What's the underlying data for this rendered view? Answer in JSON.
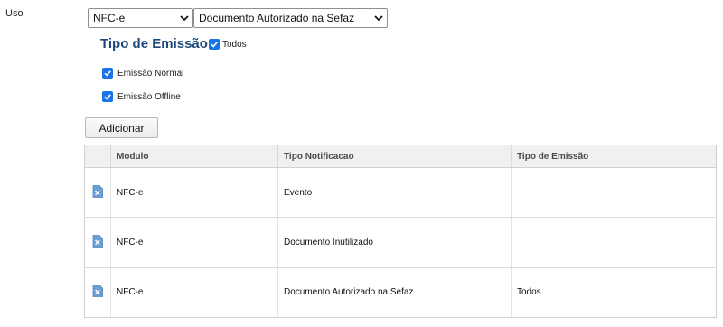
{
  "uso": {
    "label": "Uso",
    "modulo_select": {
      "value": "NFC-e",
      "icon": "chevron-down-icon"
    },
    "notificacao_select": {
      "value": "Documento Autorizado na Sefaz",
      "icon": "chevron-down-icon"
    }
  },
  "tipo_emissao": {
    "title": "Tipo de Emissão",
    "todos": {
      "label": "Todos",
      "checked": true
    },
    "options": [
      {
        "label": "Emissão Normal",
        "checked": true
      },
      {
        "label": "Emissão Offline",
        "checked": true
      }
    ]
  },
  "add_button": {
    "label": "Adicionar"
  },
  "table": {
    "columns": [
      "",
      "Modulo",
      "Tipo Notificacao",
      "Tipo de Emissão"
    ],
    "rows": [
      {
        "modulo": "NFC-e",
        "tipo_notificacao": "Evento",
        "tipo_emissao": ""
      },
      {
        "modulo": "NFC-e",
        "tipo_notificacao": "Documento Inutilizado",
        "tipo_emissao": ""
      },
      {
        "modulo": "NFC-e",
        "tipo_notificacao": "Documento Autorizado na Sefaz",
        "tipo_emissao": "Todos"
      }
    ],
    "row_icon": "delete-document-icon"
  },
  "colors": {
    "accent": "#1a73e8",
    "title": "#1c4a7b",
    "header_bg": "#f0f0f0",
    "delete_icon": "#6a9fd4"
  }
}
